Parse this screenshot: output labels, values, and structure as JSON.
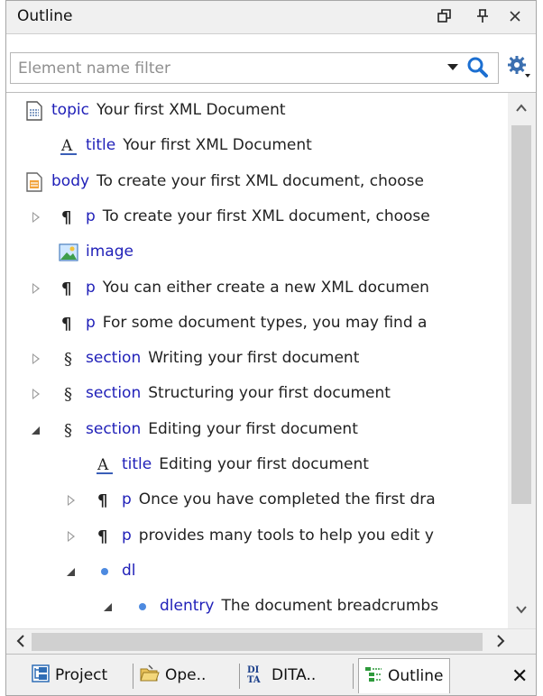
{
  "panel": {
    "title": "Outline",
    "title_icons": [
      "restore-icon",
      "pin-icon",
      "close-icon"
    ],
    "title_glyphs": {
      "restore": "❐",
      "pin": "ᚔ",
      "close": "✕"
    }
  },
  "filter": {
    "placeholder": "Element name filter",
    "value": ""
  },
  "tree": {
    "rows": [
      {
        "element": "topic",
        "text": "Your first XML Document",
        "icon": "topic-doc-icon",
        "toggle": "none",
        "depth": 0
      },
      {
        "element": "title",
        "text": "Your first XML Document",
        "icon": "title-A-icon",
        "toggle": "none",
        "depth": 1
      },
      {
        "element": "body",
        "text": "To create your first XML document, choose",
        "icon": "body-doc-icon",
        "toggle": "expanded",
        "depth": 0
      },
      {
        "element": "p",
        "text": "To create your first XML document, choose",
        "icon": "pilcrow-icon",
        "toggle": "collapsed",
        "depth": 1
      },
      {
        "element": "image",
        "text": "",
        "icon": "image-icon",
        "toggle": "none",
        "depth": 1
      },
      {
        "element": "p",
        "text": "You can either create a new XML documen",
        "icon": "pilcrow-icon",
        "toggle": "collapsed",
        "depth": 1
      },
      {
        "element": "p",
        "text": "For some document types, you may find a",
        "icon": "pilcrow-icon",
        "toggle": "none",
        "depth": 1
      },
      {
        "element": "section",
        "text": "Writing your first document",
        "icon": "section-icon",
        "toggle": "collapsed",
        "depth": 1
      },
      {
        "element": "section",
        "text": "Structuring your first document",
        "icon": "section-icon",
        "toggle": "collapsed",
        "depth": 1
      },
      {
        "element": "section",
        "text": "Editing your first document",
        "icon": "section-icon",
        "toggle": "expanded",
        "depth": 1
      },
      {
        "element": "title",
        "text": "Editing your first document",
        "icon": "title-A-icon",
        "toggle": "none",
        "depth": 2
      },
      {
        "element": "p",
        "text": "Once you have completed the first dra",
        "icon": "pilcrow-icon",
        "toggle": "collapsed",
        "depth": 2
      },
      {
        "element": "p",
        "text": "provides many tools to help you edit y",
        "icon": "pilcrow-icon",
        "toggle": "collapsed",
        "depth": 2
      },
      {
        "element": "dl",
        "text": "",
        "icon": "bullet-icon",
        "toggle": "expanded",
        "depth": 2
      },
      {
        "element": "dlentry",
        "text": "The document breadcrumbs",
        "icon": "bullet-icon",
        "toggle": "expanded",
        "depth": 3
      }
    ]
  },
  "tabs": [
    {
      "label": "Project",
      "icon": "project-icon",
      "active": false
    },
    {
      "label": "Ope..",
      "icon": "open-folder-icon",
      "active": false
    },
    {
      "label": "DITA..",
      "icon": "dita-icon",
      "active": false
    },
    {
      "label": "Outline",
      "icon": "outline-icon",
      "active": true
    }
  ],
  "tab_close_glyph": "✕",
  "colors": {
    "element_name": "#1f1fb8",
    "text": "#222222",
    "chrome": "#f0f0f0"
  }
}
